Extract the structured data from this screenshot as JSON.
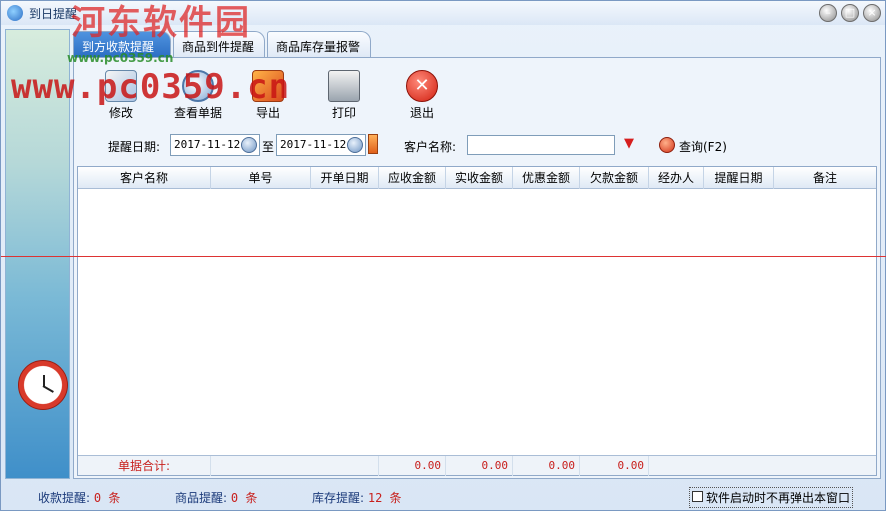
{
  "window": {
    "title": "到日提醒"
  },
  "watermark": {
    "site_cn": "河东软件园",
    "url": "www.pc0359.cn",
    "url_small": "www.pc0359.cn"
  },
  "tabs": [
    {
      "label": "到方收款提醒",
      "active": true
    },
    {
      "label": "商品到件提醒",
      "active": false
    },
    {
      "label": "商品库存量报警",
      "active": false
    }
  ],
  "toolbar": {
    "edit": "修改",
    "view": "查看单据",
    "export": "导出",
    "print": "打印",
    "exit": "退出"
  },
  "search": {
    "date_label": "提醒日期:",
    "date_from": "2017-11-12",
    "to_label": "至",
    "date_to": "2017-11-12",
    "customer_label": "客户名称:",
    "customer_value": "",
    "query_label": "查询(F2)"
  },
  "grid": {
    "columns": [
      "客户名称",
      "单号",
      "开单日期",
      "应收金额",
      "实收金额",
      "优惠金额",
      "欠款金额",
      "经办人",
      "提醒日期",
      "备注"
    ],
    "rows": [],
    "footer": {
      "label": "单据合计:",
      "receivable": "0.00",
      "received": "0.00",
      "discount": "0.00",
      "arrears": "0.00"
    }
  },
  "status": {
    "receipt_label": "收款提醒:",
    "receipt_count": "0 条",
    "goods_label": "商品提醒:",
    "goods_count": "0 条",
    "stock_label": "库存提醒:",
    "stock_count": "12 条",
    "checkbox_label": "软件启动时不再弹出本窗口",
    "checkbox_checked": false
  },
  "colors": {
    "accent": "#2d6fc4",
    "alert": "#c8201d",
    "status_key": "#1b3a7a"
  }
}
